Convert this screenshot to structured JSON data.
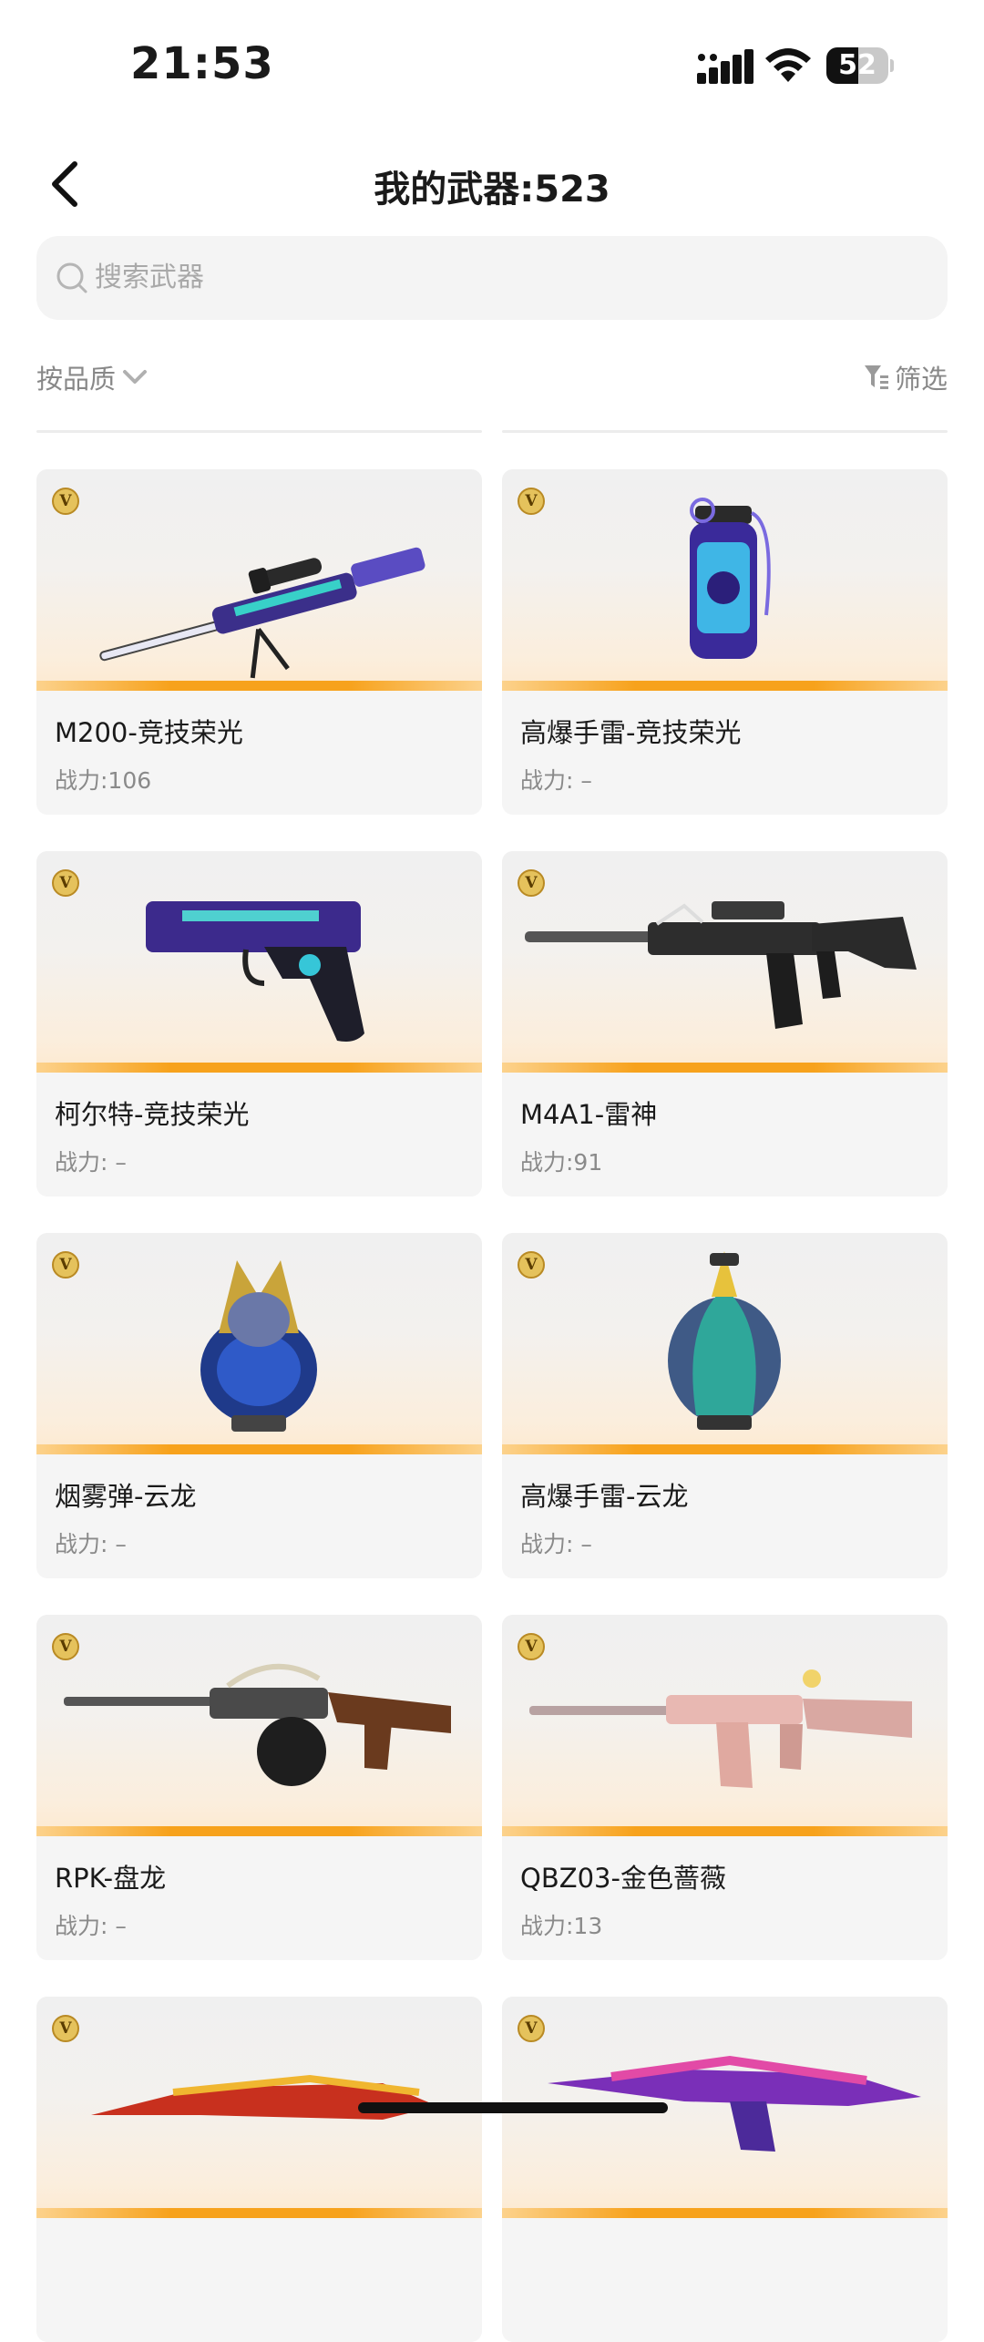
{
  "status_bar": {
    "time": "21:53",
    "battery": "52",
    "battery_level": 0.52
  },
  "header": {
    "title": "我的武器:523"
  },
  "search": {
    "placeholder": "搜索武器"
  },
  "toolbar": {
    "sort_label": "按品质",
    "filter_label": "筛选"
  },
  "weapons": [
    {
      "name": "M200-竞技荣光",
      "power": "战力:106",
      "icon": "sniper-rifle-icon",
      "badge": "V"
    },
    {
      "name": "高爆手雷-竞技荣光",
      "power": "战力: –",
      "icon": "grenade-icon",
      "badge": "V"
    },
    {
      "name": "柯尔特-竞技荣光",
      "power": "战力: –",
      "icon": "pistol-icon",
      "badge": "V"
    },
    {
      "name": "M4A1-雷神",
      "power": "战力:91",
      "icon": "assault-rifle-icon",
      "badge": "V"
    },
    {
      "name": "烟雾弹-云龙",
      "power": "战力: –",
      "icon": "smoke-grenade-icon",
      "badge": "V"
    },
    {
      "name": "高爆手雷-云龙",
      "power": "战力: –",
      "icon": "grenade-icon",
      "badge": "V"
    },
    {
      "name": "RPK-盘龙",
      "power": "战力: –",
      "icon": "machine-gun-icon",
      "badge": "V"
    },
    {
      "name": "QBZ03-金色蔷薇",
      "power": "战力:13",
      "icon": "assault-rifle-icon",
      "badge": "V"
    },
    {
      "name": "",
      "power": "",
      "icon": "rifle-icon",
      "badge": "V"
    },
    {
      "name": "",
      "power": "",
      "icon": "rifle-icon",
      "badge": "V"
    }
  ],
  "colors": {
    "accent": "#f7a21c",
    "card_bg": "#f5f5f5",
    "badge": "#e5c25c"
  }
}
